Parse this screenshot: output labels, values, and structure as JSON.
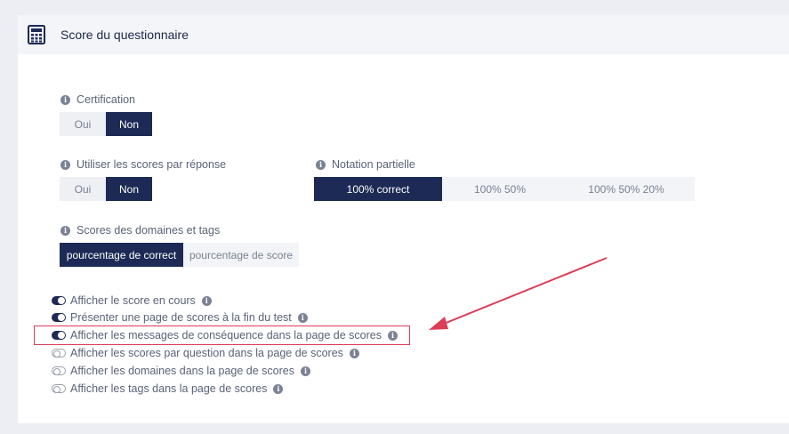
{
  "header": {
    "title": "Score du questionnaire",
    "icon": "calculator-icon"
  },
  "certification": {
    "label": "Certification",
    "options": [
      "Oui",
      "Non"
    ],
    "selected": "Non"
  },
  "scores_par_reponse": {
    "label": "Utiliser les scores par réponse",
    "options": [
      "Oui",
      "Non"
    ],
    "selected": "Non"
  },
  "notation_partielle": {
    "label": "Notation partielle",
    "options": [
      "100% correct",
      "100% 50%",
      "100% 50% 20%"
    ],
    "selected": "100% correct"
  },
  "domaines_tags": {
    "label": "Scores des domaines et tags",
    "options": [
      "pourcentage de correct",
      "pourcentage de score"
    ],
    "selected": "pourcentage de correct"
  },
  "toggles": [
    {
      "label": "Afficher le score en cours",
      "on": true
    },
    {
      "label": "Présenter une page de scores à la fin du test",
      "on": true
    },
    {
      "label": "Afficher les messages de conséquence dans la page de scores",
      "on": true
    },
    {
      "label": "Afficher les scores par question dans la page de scores",
      "on": false
    },
    {
      "label": "Afficher les domaines dans la page de scores",
      "on": false
    },
    {
      "label": "Afficher les tags dans la page de scores",
      "on": false
    }
  ],
  "colors": {
    "accent": "#1c2a55",
    "highlight": "#dc3d57",
    "header_bg": "#f4f5f9"
  }
}
